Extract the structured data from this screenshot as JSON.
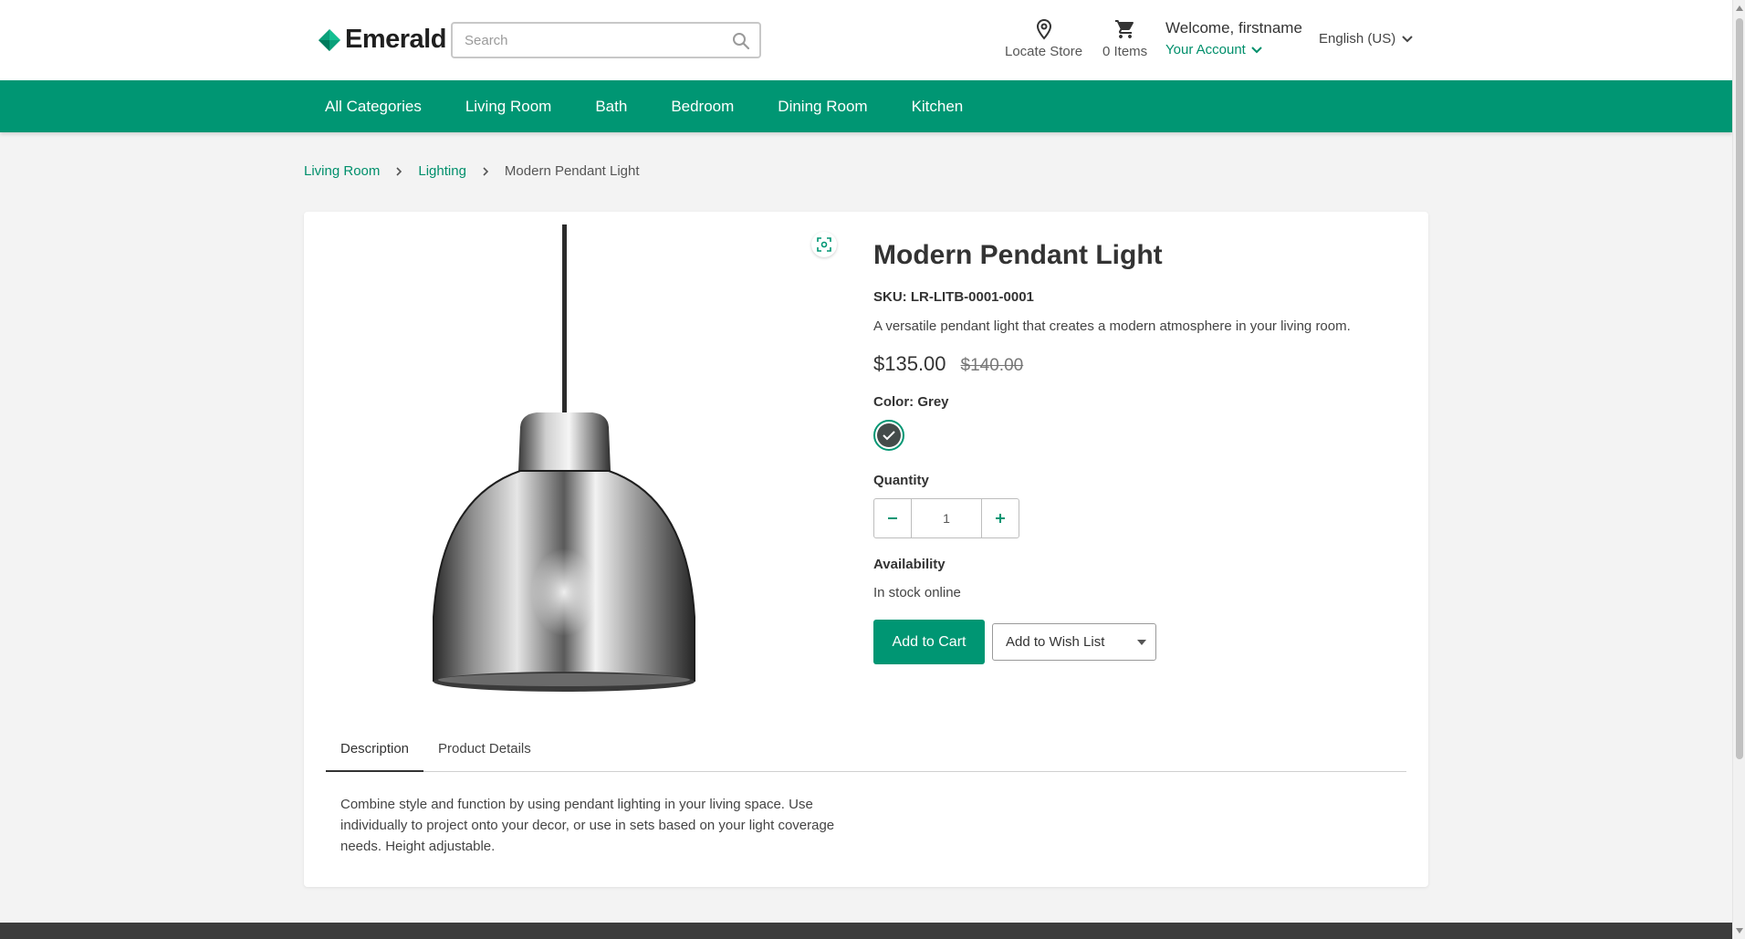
{
  "brand": {
    "name": "Emerald",
    "accent": "#009673",
    "logo_icon": "diamond-logo-icon"
  },
  "search": {
    "placeholder": "Search",
    "value": "",
    "icon": "search-icon"
  },
  "header": {
    "locate_store": "Locate Store",
    "cart_items": "0 Items",
    "welcome": "Welcome, firstname",
    "account": "Your Account",
    "language": "English (US)"
  },
  "nav": {
    "items": [
      {
        "label": "All Categories"
      },
      {
        "label": "Living Room"
      },
      {
        "label": "Bath"
      },
      {
        "label": "Bedroom"
      },
      {
        "label": "Dining Room"
      },
      {
        "label": "Kitchen"
      }
    ]
  },
  "breadcrumb": {
    "items": [
      {
        "label": "Living Room"
      },
      {
        "label": "Lighting"
      },
      {
        "label": "Modern Pendant Light"
      }
    ]
  },
  "product": {
    "title": "Modern Pendant Light",
    "sku": "SKU: LR-LITB-0001-0001",
    "description": "A versatile pendant light that creates a modern atmosphere in your living room.",
    "price": "$135.00",
    "price_old": "$140.00",
    "color_label": "Color: Grey",
    "swatch_color": "#444b4a",
    "quantity_label": "Quantity",
    "quantity_value": "1",
    "availability_label": "Availability",
    "availability_value": "In stock online",
    "add_to_cart": "Add to Cart",
    "add_to_wishlist": "Add to Wish List"
  },
  "tabs": {
    "items": [
      {
        "label": "Description"
      },
      {
        "label": "Product Details"
      }
    ],
    "active_index": 0,
    "description_body": "Combine style and function by using pendant lighting in your living space. Use individually to project onto your decor, or use in sets based on your light coverage needs. Height adjustable."
  }
}
